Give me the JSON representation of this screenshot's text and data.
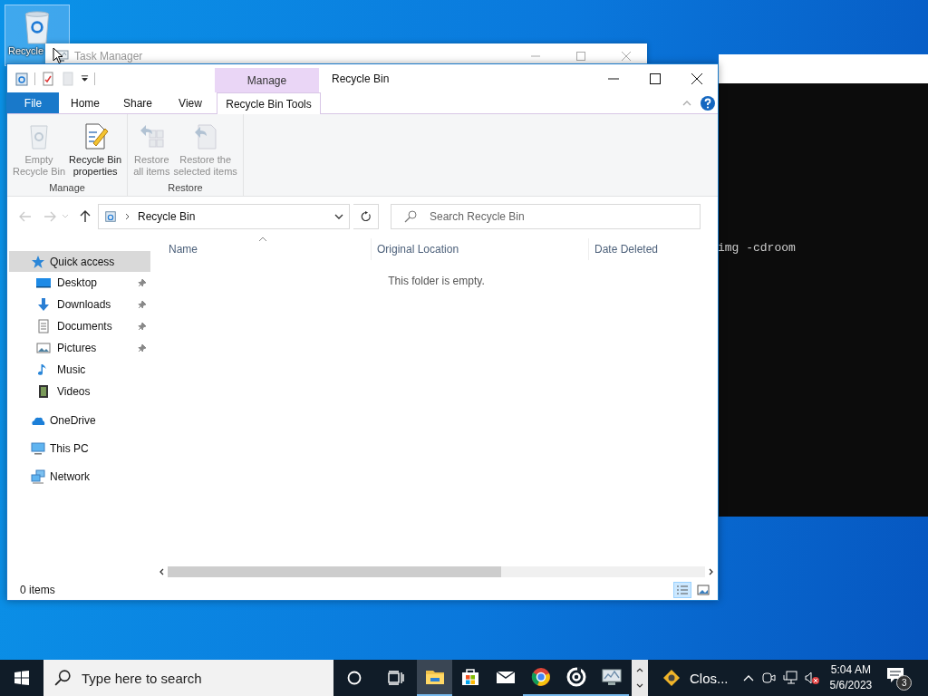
{
  "desktop": {
    "icons": [
      {
        "label": "Recycle",
        "selected": true
      }
    ]
  },
  "task_manager": {
    "title": "Task Manager"
  },
  "terminal": {
    "lines": [
      "img -cdroom"
    ]
  },
  "explorer": {
    "title": "Recycle Bin",
    "context_group": "Manage",
    "tabs": [
      {
        "label": "File",
        "kind": "file",
        "selected": false
      },
      {
        "label": "Home",
        "kind": "tab",
        "selected": false
      },
      {
        "label": "Share",
        "kind": "tab",
        "selected": false
      },
      {
        "label": "View",
        "kind": "tab",
        "selected": false
      },
      {
        "label": "Recycle Bin Tools",
        "kind": "context",
        "selected": true
      }
    ],
    "ribbon": [
      {
        "label": "Manage",
        "commands": [
          {
            "label": "Empty\nRecycle Bin",
            "disabled": true
          },
          {
            "label": "Recycle Bin\nproperties",
            "disabled": false
          }
        ]
      },
      {
        "label": "Restore",
        "commands": [
          {
            "label": "Restore\nall items",
            "disabled": true
          },
          {
            "label": "Restore the\nselected items",
            "disabled": true
          }
        ]
      }
    ],
    "history": {
      "back_enabled": false,
      "forward_enabled": false
    },
    "address": {
      "path": "Recycle Bin"
    },
    "search": {
      "placeholder": "Search Recycle Bin"
    },
    "navigation": [
      {
        "label": "Quick access",
        "selected": true,
        "children": [
          {
            "label": "Desktop",
            "pinned": true,
            "selected": false
          },
          {
            "label": "Downloads",
            "pinned": true,
            "selected": false
          },
          {
            "label": "Documents",
            "pinned": true,
            "selected": false
          },
          {
            "label": "Pictures",
            "pinned": true,
            "selected": false
          },
          {
            "label": "Music",
            "pinned": false,
            "selected": false
          },
          {
            "label": "Videos",
            "pinned": false,
            "selected": false
          }
        ]
      },
      {
        "label": "OneDrive",
        "selected": false
      },
      {
        "label": "This PC",
        "selected": false
      },
      {
        "label": "Network",
        "selected": false
      }
    ],
    "columns": [
      {
        "label": "Name",
        "sorted": true
      },
      {
        "label": "Original Location",
        "sorted": false
      },
      {
        "label": "Date Deleted",
        "sorted": false
      }
    ],
    "empty_message": "This folder is empty.",
    "status": "0 items",
    "views": [
      {
        "selected": true
      },
      {
        "selected": false
      }
    ]
  },
  "taskbar": {
    "search": {
      "placeholder": "Type here to search"
    },
    "pinned": [
      {
        "active": true,
        "running": true
      },
      {
        "active": false,
        "running": false
      },
      {
        "active": false,
        "running": false
      },
      {
        "active": false,
        "running": true
      },
      {
        "active": false,
        "running": true
      },
      {
        "active": false,
        "running": true
      }
    ],
    "running_app": {
      "label": "Clos..."
    },
    "clock": {
      "time": "5:04 AM",
      "date": "5/6/2023"
    },
    "notifications": {
      "count": "3"
    }
  }
}
